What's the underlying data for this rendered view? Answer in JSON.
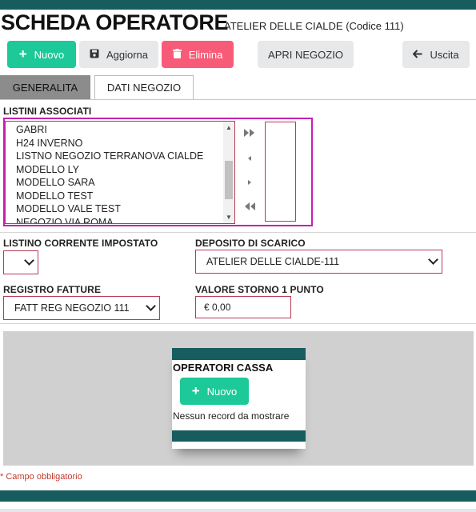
{
  "header": {
    "title": "SCHEDA OPERATORE",
    "subtitle": "ATELIER DELLE CIALDE (Codice 111)"
  },
  "toolbar": {
    "new_label": "Nuovo",
    "update_label": "Aggiorna",
    "delete_label": "Elimina",
    "open_store_label": "APRI NEGOZIO",
    "exit_label": "Uscita"
  },
  "tabs": [
    {
      "label": "GENERALITA",
      "active": false
    },
    {
      "label": "DATI NEGOZIO",
      "active": true
    }
  ],
  "listini": {
    "label": "LISTINI ASSOCIATI",
    "available": [
      "GABRI",
      "H24 INVERNO",
      "LISTNO NEGOZIO TERRANOVA CIALDE",
      "MODELLO LY",
      "MODELLO SARA",
      "MODELLO TEST",
      "MODELLO VALE TEST",
      "NEGOZIO VIA ROMA"
    ],
    "selected": []
  },
  "form": {
    "listino_corrente_label": "LISTINO CORRENTE IMPOSTATO",
    "listino_corrente_value": "",
    "deposito_label": "DEPOSITO DI SCARICO",
    "deposito_value": "ATELIER DELLE CIALDE-111",
    "registro_label": "REGISTRO FATTURE",
    "registro_value": "FATT REG NEGOZIO 111",
    "storno_label": "VALORE STORNO 1 PUNTO",
    "storno_value": "€ 0,00"
  },
  "operatori_cassa": {
    "title": "OPERATORI CASSA",
    "new_label": "Nuovo",
    "empty_text": "Nessun record da mostrare"
  },
  "footer": {
    "required_note": "* Campo obbligatorio"
  },
  "colors": {
    "brand_teal": "#175c5f",
    "green": "#1dc998",
    "red": "#f85b78",
    "highlight": "#c51fb5"
  }
}
